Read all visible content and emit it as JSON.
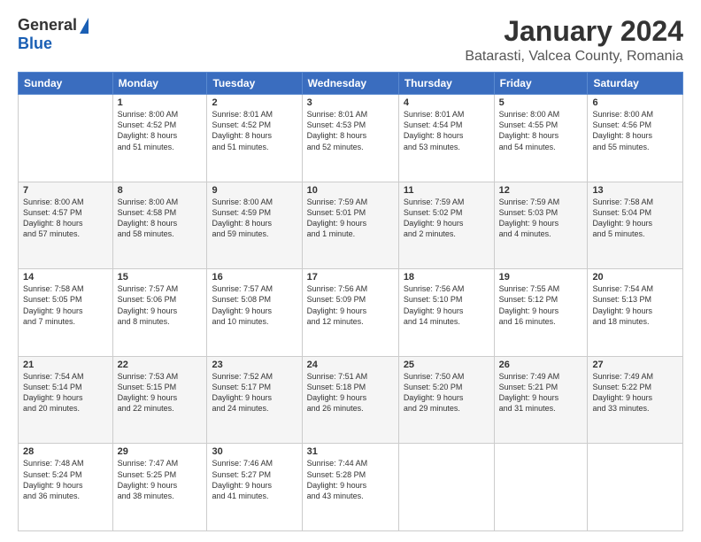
{
  "header": {
    "logo": {
      "general": "General",
      "blue": "Blue"
    },
    "month": "January 2024",
    "location": "Batarasti, Valcea County, Romania"
  },
  "days_of_week": [
    "Sunday",
    "Monday",
    "Tuesday",
    "Wednesday",
    "Thursday",
    "Friday",
    "Saturday"
  ],
  "weeks": [
    [
      {
        "day": "",
        "info": ""
      },
      {
        "day": "1",
        "info": "Sunrise: 8:00 AM\nSunset: 4:52 PM\nDaylight: 8 hours\nand 51 minutes."
      },
      {
        "day": "2",
        "info": "Sunrise: 8:01 AM\nSunset: 4:52 PM\nDaylight: 8 hours\nand 51 minutes."
      },
      {
        "day": "3",
        "info": "Sunrise: 8:01 AM\nSunset: 4:53 PM\nDaylight: 8 hours\nand 52 minutes."
      },
      {
        "day": "4",
        "info": "Sunrise: 8:01 AM\nSunset: 4:54 PM\nDaylight: 8 hours\nand 53 minutes."
      },
      {
        "day": "5",
        "info": "Sunrise: 8:00 AM\nSunset: 4:55 PM\nDaylight: 8 hours\nand 54 minutes."
      },
      {
        "day": "6",
        "info": "Sunrise: 8:00 AM\nSunset: 4:56 PM\nDaylight: 8 hours\nand 55 minutes."
      }
    ],
    [
      {
        "day": "7",
        "info": "Sunrise: 8:00 AM\nSunset: 4:57 PM\nDaylight: 8 hours\nand 57 minutes."
      },
      {
        "day": "8",
        "info": "Sunrise: 8:00 AM\nSunset: 4:58 PM\nDaylight: 8 hours\nand 58 minutes."
      },
      {
        "day": "9",
        "info": "Sunrise: 8:00 AM\nSunset: 4:59 PM\nDaylight: 8 hours\nand 59 minutes."
      },
      {
        "day": "10",
        "info": "Sunrise: 7:59 AM\nSunset: 5:01 PM\nDaylight: 9 hours\nand 1 minute."
      },
      {
        "day": "11",
        "info": "Sunrise: 7:59 AM\nSunset: 5:02 PM\nDaylight: 9 hours\nand 2 minutes."
      },
      {
        "day": "12",
        "info": "Sunrise: 7:59 AM\nSunset: 5:03 PM\nDaylight: 9 hours\nand 4 minutes."
      },
      {
        "day": "13",
        "info": "Sunrise: 7:58 AM\nSunset: 5:04 PM\nDaylight: 9 hours\nand 5 minutes."
      }
    ],
    [
      {
        "day": "14",
        "info": "Sunrise: 7:58 AM\nSunset: 5:05 PM\nDaylight: 9 hours\nand 7 minutes."
      },
      {
        "day": "15",
        "info": "Sunrise: 7:57 AM\nSunset: 5:06 PM\nDaylight: 9 hours\nand 8 minutes."
      },
      {
        "day": "16",
        "info": "Sunrise: 7:57 AM\nSunset: 5:08 PM\nDaylight: 9 hours\nand 10 minutes."
      },
      {
        "day": "17",
        "info": "Sunrise: 7:56 AM\nSunset: 5:09 PM\nDaylight: 9 hours\nand 12 minutes."
      },
      {
        "day": "18",
        "info": "Sunrise: 7:56 AM\nSunset: 5:10 PM\nDaylight: 9 hours\nand 14 minutes."
      },
      {
        "day": "19",
        "info": "Sunrise: 7:55 AM\nSunset: 5:12 PM\nDaylight: 9 hours\nand 16 minutes."
      },
      {
        "day": "20",
        "info": "Sunrise: 7:54 AM\nSunset: 5:13 PM\nDaylight: 9 hours\nand 18 minutes."
      }
    ],
    [
      {
        "day": "21",
        "info": "Sunrise: 7:54 AM\nSunset: 5:14 PM\nDaylight: 9 hours\nand 20 minutes."
      },
      {
        "day": "22",
        "info": "Sunrise: 7:53 AM\nSunset: 5:15 PM\nDaylight: 9 hours\nand 22 minutes."
      },
      {
        "day": "23",
        "info": "Sunrise: 7:52 AM\nSunset: 5:17 PM\nDaylight: 9 hours\nand 24 minutes."
      },
      {
        "day": "24",
        "info": "Sunrise: 7:51 AM\nSunset: 5:18 PM\nDaylight: 9 hours\nand 26 minutes."
      },
      {
        "day": "25",
        "info": "Sunrise: 7:50 AM\nSunset: 5:20 PM\nDaylight: 9 hours\nand 29 minutes."
      },
      {
        "day": "26",
        "info": "Sunrise: 7:49 AM\nSunset: 5:21 PM\nDaylight: 9 hours\nand 31 minutes."
      },
      {
        "day": "27",
        "info": "Sunrise: 7:49 AM\nSunset: 5:22 PM\nDaylight: 9 hours\nand 33 minutes."
      }
    ],
    [
      {
        "day": "28",
        "info": "Sunrise: 7:48 AM\nSunset: 5:24 PM\nDaylight: 9 hours\nand 36 minutes."
      },
      {
        "day": "29",
        "info": "Sunrise: 7:47 AM\nSunset: 5:25 PM\nDaylight: 9 hours\nand 38 minutes."
      },
      {
        "day": "30",
        "info": "Sunrise: 7:46 AM\nSunset: 5:27 PM\nDaylight: 9 hours\nand 41 minutes."
      },
      {
        "day": "31",
        "info": "Sunrise: 7:44 AM\nSunset: 5:28 PM\nDaylight: 9 hours\nand 43 minutes."
      },
      {
        "day": "",
        "info": ""
      },
      {
        "day": "",
        "info": ""
      },
      {
        "day": "",
        "info": ""
      }
    ]
  ]
}
